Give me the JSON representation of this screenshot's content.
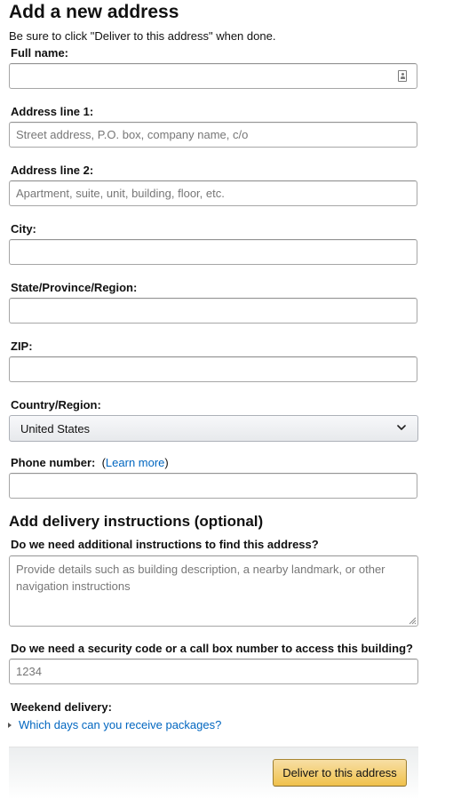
{
  "header": {
    "title": "Add a new address",
    "subtitle": "Be sure to click \"Deliver to this address\" when done."
  },
  "form": {
    "full_name": {
      "label": "Full name:",
      "value": "",
      "placeholder": "",
      "icon": "contact-card-icon"
    },
    "address_line_1": {
      "label": "Address line 1:",
      "value": "",
      "placeholder": "Street address, P.O. box, company name, c/o"
    },
    "address_line_2": {
      "label": "Address line 2:",
      "value": "",
      "placeholder": "Apartment, suite, unit, building, floor, etc."
    },
    "city": {
      "label": "City:",
      "value": "",
      "placeholder": ""
    },
    "state": {
      "label": "State/Province/Region:",
      "value": "",
      "placeholder": ""
    },
    "zip": {
      "label": "ZIP:",
      "value": "",
      "placeholder": ""
    },
    "country": {
      "label": "Country/Region:",
      "selected": "United States",
      "icon": "chevron-down-icon"
    },
    "phone": {
      "label": "Phone number:",
      "link_open": "(",
      "learn_more": "Learn more",
      "link_close": ")",
      "value": "",
      "placeholder": ""
    }
  },
  "delivery_instructions": {
    "title": "Add delivery instructions (optional)",
    "find_address": {
      "label": "Do we need additional instructions to find this address?",
      "placeholder": "Provide details such as building description, a nearby landmark, or other navigation instructions"
    },
    "security_code": {
      "label": "Do we need a security code or a call box number to access this building?",
      "placeholder": "1234"
    },
    "weekend": {
      "label": "Weekend delivery:",
      "link": "Which days can you receive packages?",
      "icon": "disclosure-triangle-icon"
    }
  },
  "footer": {
    "deliver_button": "Deliver to this address"
  },
  "colors": {
    "link": "#0066c0",
    "button_top": "#f7dfa5",
    "button_bottom": "#f0c14b"
  }
}
